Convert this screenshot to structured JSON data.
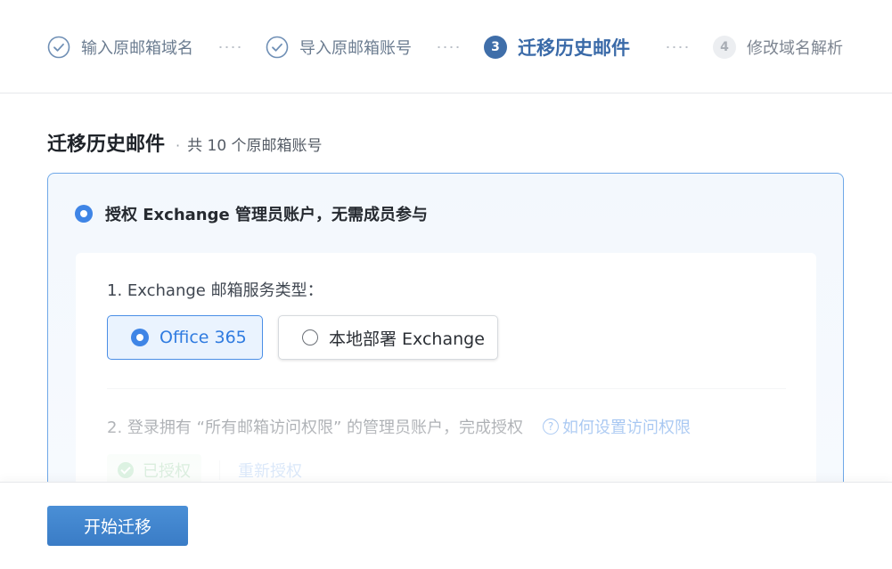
{
  "stepper": {
    "steps": [
      {
        "label": "输入原邮箱域名",
        "state": "done"
      },
      {
        "label": "导入原邮箱账号",
        "state": "done"
      },
      {
        "number": "3",
        "label": "迁移历史邮件",
        "state": "current"
      },
      {
        "number": "4",
        "label": "修改域名解析",
        "state": "pending"
      }
    ]
  },
  "section": {
    "title": "迁移历史邮件",
    "separator": "·",
    "subtitle": "共 10 个原邮箱账号"
  },
  "card": {
    "option_label": "授权 Exchange 管理员账户，无需成员参与",
    "question1": "1. Exchange 邮箱服务类型：",
    "service_options": [
      {
        "label": "Office 365",
        "selected": true
      },
      {
        "label": "本地部署 Exchange",
        "selected": false
      }
    ],
    "question2": "2. 登录拥有 “所有邮箱访问权限” 的管理员账户，完成授权",
    "help_link": "如何设置访问权限",
    "help_icon": "?",
    "authorized_label": "已授权",
    "reauthorize_label": "重新授权"
  },
  "footer": {
    "start_button": "开始迁移"
  },
  "colors": {
    "accent": "#3f85e6",
    "step_current": "#3f6ea9",
    "success": "#3bb55a",
    "button": "#3a7cc6"
  }
}
